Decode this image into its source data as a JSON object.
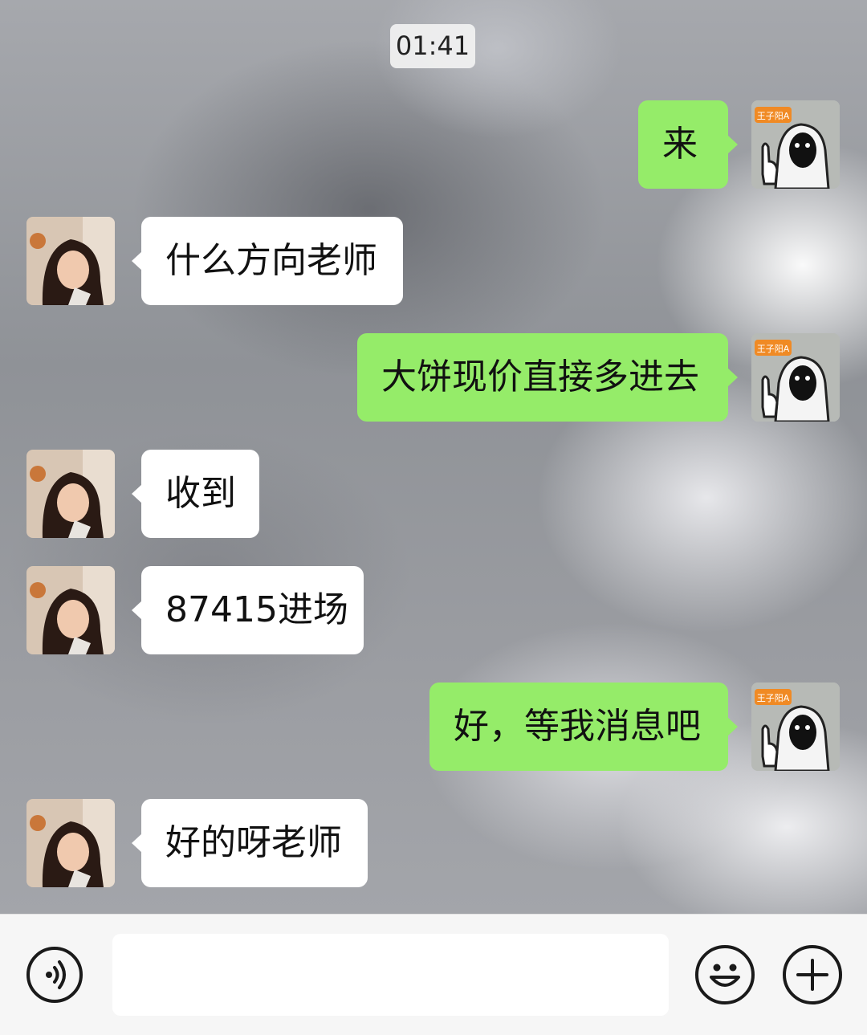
{
  "timestamp": "01:41",
  "avatars": {
    "me_badge_text": "王子阳A"
  },
  "messages": [
    {
      "sender": "me",
      "text": "来"
    },
    {
      "sender": "other",
      "text": "什么方向老师"
    },
    {
      "sender": "me",
      "text": "大饼现价直接多进去"
    },
    {
      "sender": "other",
      "text": "收到"
    },
    {
      "sender": "other",
      "text": "87415进场"
    },
    {
      "sender": "me",
      "text": "好，等我消息吧"
    },
    {
      "sender": "other",
      "text": "好的呀老师"
    }
  ],
  "input_bar": {
    "voice_icon": "voice-icon",
    "text_value": "",
    "emoji_icon": "emoji-icon",
    "plus_icon": "plus-icon"
  },
  "colors": {
    "sent_bubble": "#95ec69",
    "received_bubble": "#ffffff",
    "input_bar_bg": "#f6f6f6"
  }
}
